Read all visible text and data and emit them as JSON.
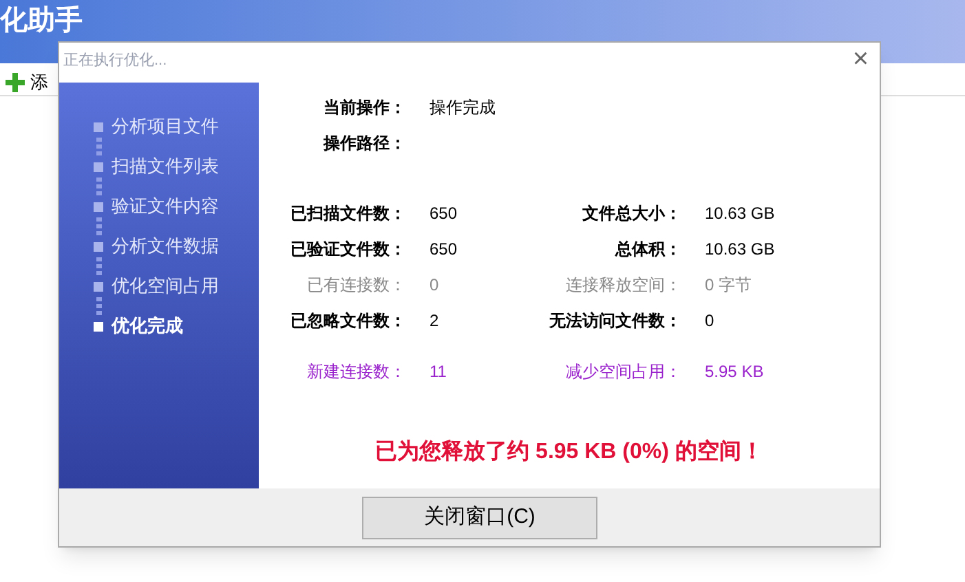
{
  "app": {
    "title": "化助手",
    "subtitle": "正在执行优化...",
    "toolbar_label": "添"
  },
  "dialog": {
    "steps": [
      {
        "label": "分析项目文件",
        "selected": false
      },
      {
        "label": "扫描文件列表",
        "selected": false
      },
      {
        "label": "验证文件内容",
        "selected": false
      },
      {
        "label": "分析文件数据",
        "selected": false
      },
      {
        "label": "优化空间占用",
        "selected": false
      },
      {
        "label": "优化完成",
        "selected": true
      }
    ],
    "operation": {
      "label": "当前操作：",
      "value": "操作完成"
    },
    "path": {
      "label": "操作路径："
    },
    "stats": [
      [
        {
          "label": "已扫描文件数：",
          "value": "650",
          "kind": "normal"
        },
        {
          "label": "文件总大小：",
          "value": "10.63 GB",
          "kind": "normal"
        }
      ],
      [
        {
          "label": "已验证文件数：",
          "value": "650",
          "kind": "normal"
        },
        {
          "label": "总体积：",
          "value": "10.63 GB",
          "kind": "normal"
        }
      ],
      [
        {
          "label": "已有连接数：",
          "value": "0",
          "kind": "disabled"
        },
        {
          "label": "连接释放空间：",
          "value": "0 字节",
          "kind": "disabled"
        }
      ],
      [
        {
          "label": "已忽略文件数：",
          "value": "2",
          "kind": "normal"
        },
        {
          "label": "无法访问文件数：",
          "value": "0",
          "kind": "normal"
        }
      ]
    ],
    "results": [
      {
        "label": "新建连接数：",
        "value": "11",
        "kind": "highlight"
      },
      {
        "label": "减少空间占用：",
        "value": "5.95 KB",
        "kind": "highlight"
      }
    ],
    "message": "已为您释放了约 5.95 KB (0%) 的空间！",
    "close_glyph": "×",
    "button": "关闭窗口(C)"
  }
}
